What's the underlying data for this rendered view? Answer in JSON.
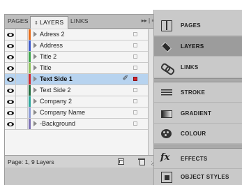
{
  "layers_panel": {
    "tabs": [
      {
        "label": "PAGES",
        "active": false
      },
      {
        "label": "LAYERS",
        "active": true
      },
      {
        "label": "LINKS",
        "active": false
      }
    ],
    "panel_menu_glyph": "▸▸ | ≡",
    "layers": [
      {
        "name": "Adress 2",
        "color": "#e66a17",
        "selected": false
      },
      {
        "name": "Address",
        "color": "#3b57c9",
        "selected": false
      },
      {
        "name": "Title 2",
        "color": "#3aa34a",
        "selected": false
      },
      {
        "name": "Title",
        "color": "#8ec25a",
        "selected": false
      },
      {
        "name": "Text Side 1",
        "color": "#d3262a",
        "selected": true
      },
      {
        "name": "Text Side 2",
        "color": "#1f6b3a",
        "selected": false
      },
      {
        "name": "Company 2",
        "color": "#2aa79b",
        "selected": false
      },
      {
        "name": "Company Name",
        "color": "#8a9ad6",
        "selected": false
      },
      {
        "name": "-Background",
        "color": "#7b6fb4",
        "selected": false
      }
    ],
    "footer_status": "Page: 1, 9 Layers",
    "pen_icon_glyph": "✐"
  },
  "dock": {
    "items": [
      {
        "label": "PAGES",
        "icon": "pages-icon",
        "active": false
      },
      {
        "label": "LAYERS",
        "icon": "layers-icon",
        "active": true
      },
      {
        "label": "LINKS",
        "icon": "links-icon",
        "active": false
      },
      {
        "label": "STROKE",
        "icon": "stroke-icon",
        "active": false
      },
      {
        "label": "GRADIENT",
        "icon": "gradient-icon",
        "active": false
      },
      {
        "label": "COLOUR",
        "icon": "colour-icon",
        "active": false
      },
      {
        "label": "EFFECTS",
        "icon": "effects-icon",
        "active": false
      },
      {
        "label": "OBJECT STYLES",
        "icon": "object-styles-icon",
        "active": false
      }
    ],
    "effects_glyph": "fx"
  }
}
